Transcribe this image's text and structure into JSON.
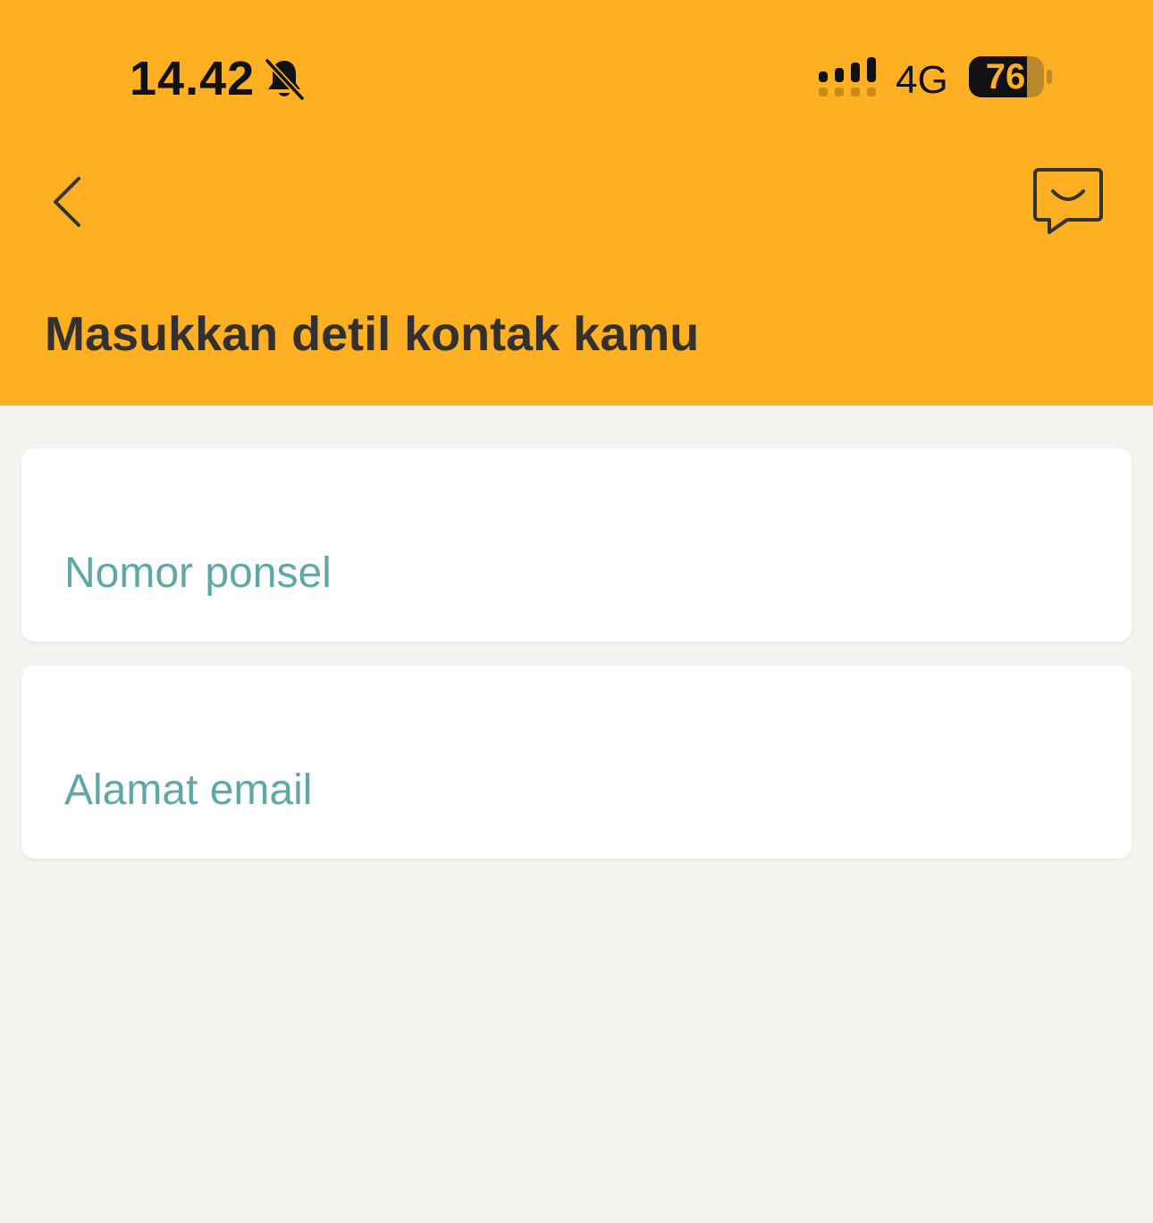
{
  "status_bar": {
    "time": "14.42",
    "network": "4G",
    "battery": "76",
    "icons": [
      "bell-muted-icon",
      "signal-icon",
      "battery-icon"
    ]
  },
  "header": {
    "title": "Masukkan detil kontak kamu",
    "back_icon": "chevron-left-icon",
    "chat_icon": "chat-smile-icon"
  },
  "form": {
    "fields": [
      {
        "label": "Nomor ponsel"
      },
      {
        "label": "Alamat email"
      }
    ]
  },
  "colors": {
    "header_bg": "#ffb022",
    "page_bg": "#f5f4f1",
    "label": "#5fa8a8",
    "title": "#333130"
  }
}
